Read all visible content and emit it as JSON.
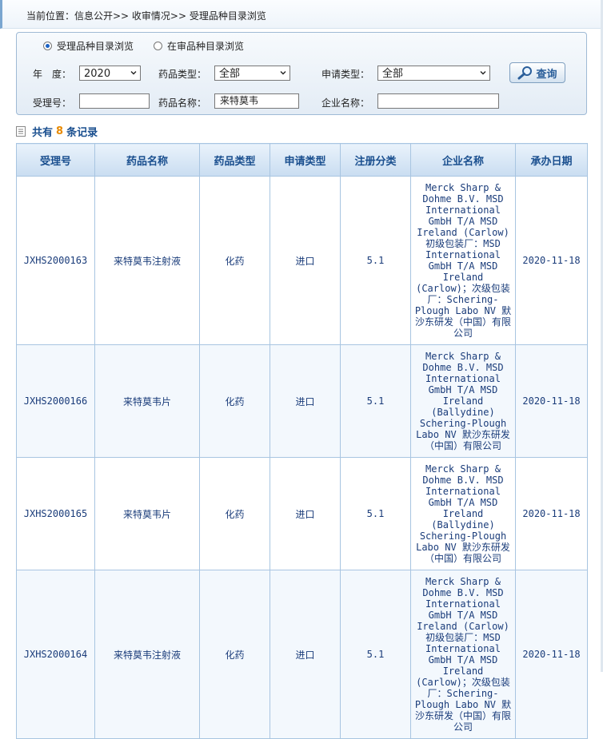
{
  "breadcrumb": {
    "text": "当前位置：信息公开>> 收审情况>> 受理品种目录浏览"
  },
  "filters": {
    "radio_options": [
      {
        "label": "受理品种目录浏览",
        "selected": true
      },
      {
        "label": "在审品种目录浏览",
        "selected": false
      }
    ],
    "year_label": "年　度：",
    "year_value": "2020",
    "drug_type_label": "药品类型：",
    "drug_type_value": "全部",
    "apply_type_label": "申请类型：",
    "apply_type_value": "全部",
    "accept_no_label": "受理号：",
    "accept_no_value": "",
    "drug_name_label": "药品名称：",
    "drug_name_value": "来特莫韦",
    "company_label": "企业名称：",
    "company_value": "",
    "query_button": "查询"
  },
  "summary": {
    "prefix": "共有",
    "count": "8",
    "suffix": "条记录"
  },
  "table": {
    "headers": [
      "受理号",
      "药品名称",
      "药品类型",
      "申请类型",
      "注册分类",
      "企业名称",
      "承办日期"
    ],
    "rows": [
      {
        "accept_no": "JXHS2000163",
        "drug_name": "来特莫韦注射液",
        "drug_type": "化药",
        "apply_type": "进口",
        "reg_class": "5.1",
        "company": "Merck Sharp & Dohme B.V. MSD International GmbH T/A MSD Ireland (Carlow) 初级包装厂：MSD International GmbH T/A MSD Ireland (Carlow)；次级包装厂：Schering-Plough Labo NV 默沙东研发（中国）有限公司",
        "date": "2020-11-18"
      },
      {
        "accept_no": "JXHS2000166",
        "drug_name": "来特莫韦片",
        "drug_type": "化药",
        "apply_type": "进口",
        "reg_class": "5.1",
        "company": "Merck Sharp & Dohme B.V. MSD International GmbH T/A MSD Ireland (Ballydine) Schering-Plough Labo NV 默沙东研发（中国）有限公司",
        "date": "2020-11-18"
      },
      {
        "accept_no": "JXHS2000165",
        "drug_name": "来特莫韦片",
        "drug_type": "化药",
        "apply_type": "进口",
        "reg_class": "5.1",
        "company": "Merck Sharp & Dohme B.V. MSD International GmbH T/A MSD Ireland (Ballydine) Schering-Plough Labo NV 默沙东研发（中国）有限公司",
        "date": "2020-11-18"
      },
      {
        "accept_no": "JXHS2000164",
        "drug_name": "来特莫韦注射液",
        "drug_type": "化药",
        "apply_type": "进口",
        "reg_class": "5.1",
        "company": "Merck Sharp & Dohme B.V. MSD International GmbH T/A MSD Ireland (Carlow) 初级包装厂：MSD International GmbH T/A MSD Ireland (Carlow)；次级包装厂：Schering-Plough Labo NV 默沙东研发（中国）有限公司",
        "date": "2020-11-18"
      }
    ]
  }
}
